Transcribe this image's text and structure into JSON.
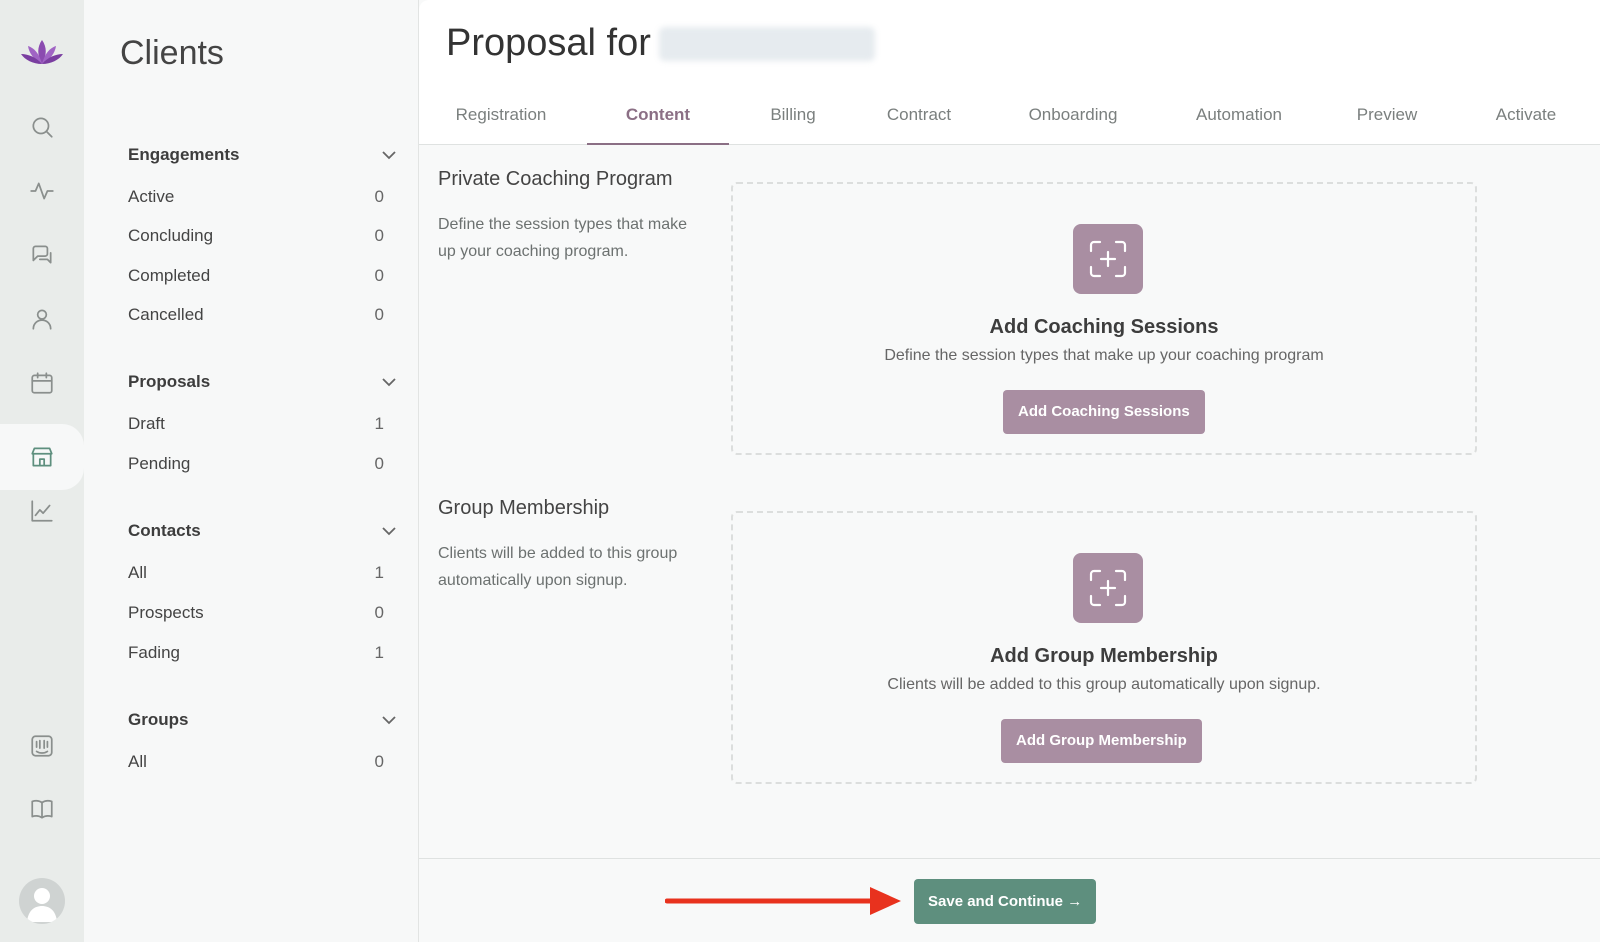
{
  "app": {
    "brand_color": "#8b4bb0"
  },
  "rail": {
    "icons": [
      "logo-icon",
      "search-icon",
      "activity-icon",
      "chat-icon",
      "user-icon",
      "calendar-icon",
      "store-icon",
      "chart-icon",
      "intercom-icon",
      "book-icon",
      "avatar-icon"
    ]
  },
  "sidebar": {
    "title": "Clients",
    "sections": [
      {
        "label": "Engagements",
        "items": [
          {
            "label": "Active",
            "count": "0"
          },
          {
            "label": "Concluding",
            "count": "0"
          },
          {
            "label": "Completed",
            "count": "0"
          },
          {
            "label": "Cancelled",
            "count": "0"
          }
        ]
      },
      {
        "label": "Proposals",
        "items": [
          {
            "label": "Draft",
            "count": "1"
          },
          {
            "label": "Pending",
            "count": "0"
          }
        ]
      },
      {
        "label": "Contacts",
        "items": [
          {
            "label": "All",
            "count": "1"
          },
          {
            "label": "Prospects",
            "count": "0"
          },
          {
            "label": "Fading",
            "count": "1"
          }
        ]
      },
      {
        "label": "Groups",
        "items": [
          {
            "label": "All",
            "count": "0"
          }
        ]
      }
    ]
  },
  "main": {
    "title": "Proposal for",
    "tabs": [
      "Registration",
      "Content",
      "Billing",
      "Contract",
      "Onboarding",
      "Automation",
      "Preview",
      "Activate"
    ],
    "active_tab": "Content",
    "blocks": [
      {
        "title": "Private Coaching Program",
        "desc": "Define the session types that make up your coaching program.",
        "dz_title": "Add Coaching Sessions",
        "dz_sub": "Define the session types that make up your coaching program",
        "dz_button": "Add Coaching Sessions"
      },
      {
        "title": "Group Membership",
        "desc": "Clients will be added to this group automatically upon signup.",
        "dz_title": "Add Group Membership",
        "dz_sub": "Clients will be added to this group automatically upon signup.",
        "dz_button": "Add Group Membership"
      }
    ],
    "save_button": "Save and Continue →",
    "accent": "#a98ea2",
    "save_color": "#5e8f7e",
    "arrow_color": "#e8321e"
  }
}
